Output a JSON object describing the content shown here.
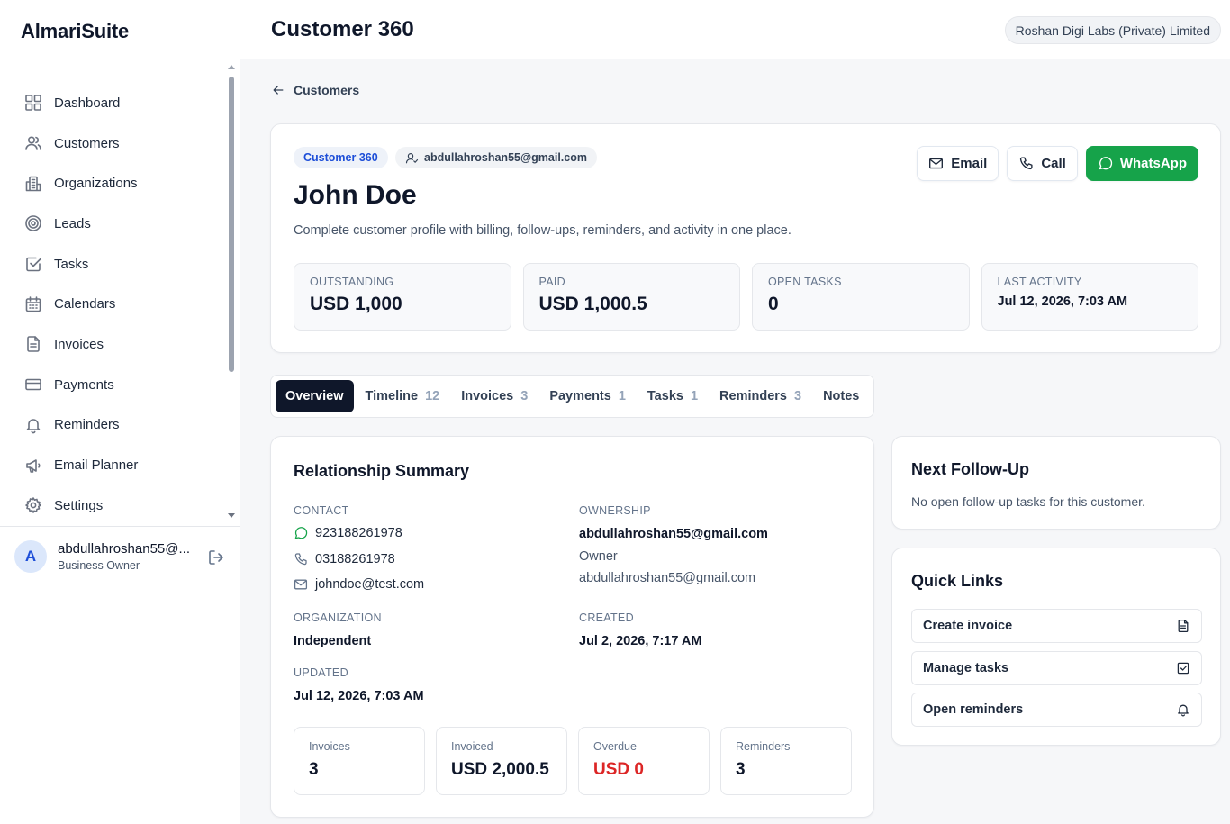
{
  "app": {
    "brand": "AlmariSuite"
  },
  "sidebar": {
    "items": [
      {
        "label": "Dashboard",
        "icon": "grid-icon"
      },
      {
        "label": "Customers",
        "icon": "users-icon"
      },
      {
        "label": "Organizations",
        "icon": "building-icon"
      },
      {
        "label": "Leads",
        "icon": "target-icon"
      },
      {
        "label": "Tasks",
        "icon": "check-square-icon"
      },
      {
        "label": "Calendars",
        "icon": "calendar-icon"
      },
      {
        "label": "Invoices",
        "icon": "file-icon"
      },
      {
        "label": "Payments",
        "icon": "card-icon"
      },
      {
        "label": "Reminders",
        "icon": "bell-icon"
      },
      {
        "label": "Email Planner",
        "icon": "megaphone-icon"
      },
      {
        "label": "Settings",
        "icon": "gear-icon"
      }
    ],
    "user": {
      "initial": "A",
      "name": "abdullahroshan55@...",
      "role": "Business Owner"
    }
  },
  "header": {
    "title": "Customer 360",
    "org": "Roshan Digi Labs (Private) Limited"
  },
  "breadcrumb": {
    "back_label": "Customers"
  },
  "customer": {
    "chip": "Customer 360",
    "owner_email": "abdullahroshan55@gmail.com",
    "name": "John Doe",
    "description": "Complete customer profile with billing, follow-ups, reminders, and activity in one place.",
    "actions": {
      "email": "Email",
      "call": "Call",
      "whatsapp": "WhatsApp"
    },
    "stats": [
      {
        "label": "OUTSTANDING",
        "value": "USD 1,000"
      },
      {
        "label": "PAID",
        "value": "USD 1,000.5"
      },
      {
        "label": "OPEN TASKS",
        "value": "0"
      },
      {
        "label": "LAST ACTIVITY",
        "value": "Jul 12, 2026, 7:03 AM"
      }
    ]
  },
  "tabs": [
    {
      "label": "Overview",
      "count": ""
    },
    {
      "label": "Timeline",
      "count": "12"
    },
    {
      "label": "Invoices",
      "count": "3"
    },
    {
      "label": "Payments",
      "count": "1"
    },
    {
      "label": "Tasks",
      "count": "1"
    },
    {
      "label": "Reminders",
      "count": "3"
    },
    {
      "label": "Notes",
      "count": ""
    }
  ],
  "summary": {
    "title": "Relationship Summary",
    "contact_label": "CONTACT",
    "whatsapp": "923188261978",
    "phone": "03188261978",
    "email": "johndoe@test.com",
    "ownership_label": "OWNERSHIP",
    "owner_email": "abdullahroshan55@gmail.com",
    "owner_role": "Owner",
    "owner_email_2": "abdullahroshan55@gmail.com",
    "organization_label": "ORGANIZATION",
    "organization": "Independent",
    "created_label": "CREATED",
    "created": "Jul 2, 2026, 7:17 AM",
    "updated_label": "UPDATED",
    "updated": "Jul 12, 2026, 7:03 AM",
    "mini": [
      {
        "label": "Invoices",
        "value": "3"
      },
      {
        "label": "Invoiced",
        "value": "USD 2,000.5"
      },
      {
        "label": "Overdue",
        "value": "USD 0"
      },
      {
        "label": "Reminders",
        "value": "3"
      }
    ],
    "overdue_color": "#dc2626"
  },
  "followup": {
    "title": "Next Follow-Up",
    "text": "No open follow-up tasks for this customer."
  },
  "quick_links": {
    "title": "Quick Links",
    "items": [
      {
        "label": "Create invoice",
        "icon": "file-icon"
      },
      {
        "label": "Manage tasks",
        "icon": "check-square-icon"
      },
      {
        "label": "Open reminders",
        "icon": "bell-icon"
      }
    ]
  },
  "colors": {
    "accent": "#1d4ed8",
    "whatsapp": "#16a34a",
    "active_tab": "#0f172a"
  }
}
